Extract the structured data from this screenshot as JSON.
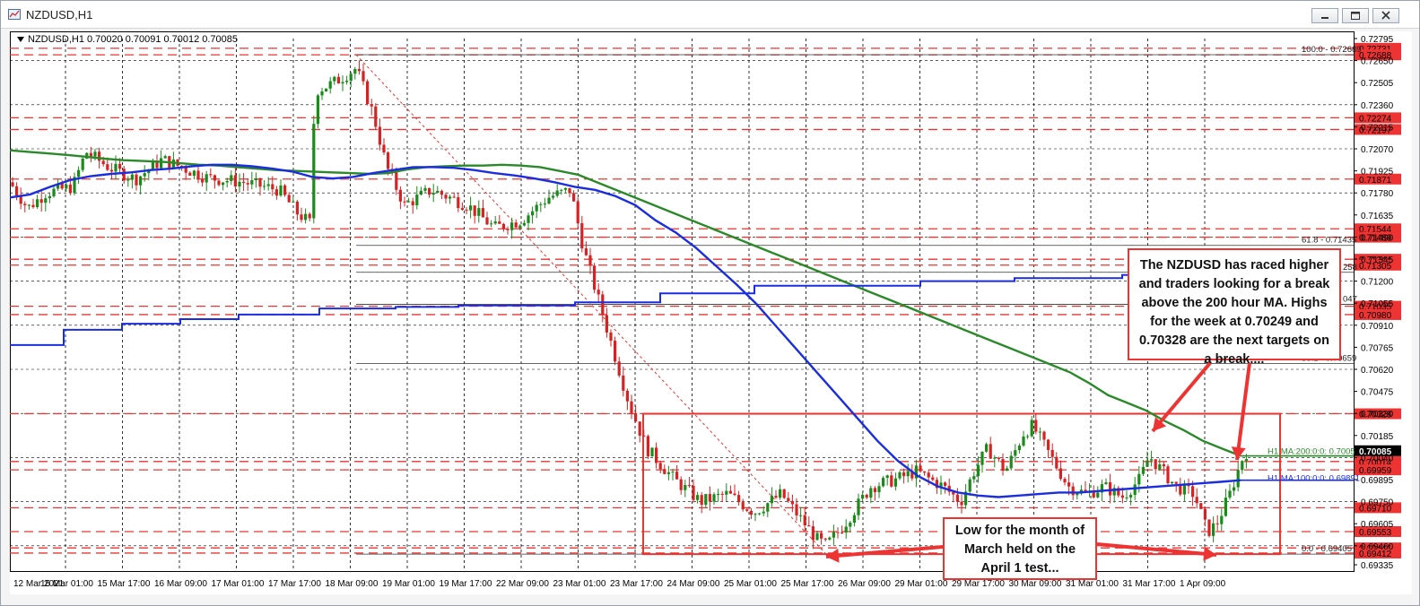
{
  "window": {
    "title": "NZDUSD,H1"
  },
  "header": {
    "symbol": "NZDUSD,H1",
    "open": "0.70020",
    "high": "0.70091",
    "low": "0.70012",
    "close": "0.70085"
  },
  "chart_data": {
    "type": "candlestick",
    "grid": true,
    "ylim": [
      0.69335,
      0.72795
    ],
    "y_ticks": [
      "0.72795",
      "0.72650",
      "0.72505",
      "0.72360",
      "0.72215",
      "0.72070",
      "0.71925",
      "0.71780",
      "0.71635",
      "0.71490",
      "0.71345",
      "0.71200",
      "0.71055",
      "0.70910",
      "0.70765",
      "0.70620",
      "0.70475",
      "0.70330",
      "0.70185",
      "0.70040",
      "0.69895",
      "0.69750",
      "0.69605",
      "0.69460",
      "0.69335"
    ],
    "x_labels": [
      "12 Mar 2021",
      "15 Mar 01:00",
      "15 Mar 17:00",
      "16 Mar 09:00",
      "17 Mar 01:00",
      "17 Mar 17:00",
      "18 Mar 09:00",
      "19 Mar 01:00",
      "19 Mar 17:00",
      "22 Mar 09:00",
      "23 Mar 01:00",
      "23 Mar 17:00",
      "24 Mar 09:00",
      "25 Mar 01:00",
      "25 Mar 17:00",
      "26 Mar 09:00",
      "29 Mar 01:00",
      "29 Mar 17:00",
      "30 Mar 09:00",
      "31 Mar 01:00",
      "31 Mar 17:00",
      "1 Apr 09:00"
    ],
    "h_levels": [
      {
        "value": 0.72731,
        "label": "0.72731"
      },
      {
        "value": 0.72688,
        "label": "0.72688"
      },
      {
        "value": 0.72274,
        "label": "0.72274"
      },
      {
        "value": 0.72197,
        "label": "0.72197"
      },
      {
        "value": 0.71871,
        "label": "0.71871"
      },
      {
        "value": 0.71544,
        "label": "0.71544"
      },
      {
        "value": 0.71489,
        "label": "0.71489"
      },
      {
        "value": 0.71344,
        "label": "0.71344"
      },
      {
        "value": 0.71305,
        "label": "0.71305"
      },
      {
        "value": 0.71035,
        "label": "0.71035"
      },
      {
        "value": 0.7098,
        "label": "0.70980"
      },
      {
        "value": 0.70328,
        "label": "0.70328"
      },
      {
        "value": 0.70014,
        "label": "0.70014"
      },
      {
        "value": 0.69959,
        "label": "0.69959"
      },
      {
        "value": 0.6971,
        "label": "0.69710"
      },
      {
        "value": 0.69553,
        "label": "0.69553"
      },
      {
        "value": 0.69446,
        "label": "0.69446"
      },
      {
        "value": 0.69412,
        "label": "0.69412"
      }
    ],
    "current_price": {
      "value": 0.70085,
      "label": "0.70085"
    },
    "fibo": [
      {
        "value": 0.72689,
        "label": "100.0 - 0.72689"
      },
      {
        "value": 0.71435,
        "label": "61.8 - 0.71435"
      },
      {
        "value": 0.71258,
        "label": "258"
      },
      {
        "value": 0.71047,
        "label": "047"
      },
      {
        "value": 0.70659,
        "label": "38.2 - 0.70659"
      },
      {
        "value": 0.69405,
        "label": "0.0 - 0.69405"
      }
    ],
    "ma_labels": {
      "ma200": "H1 MA:200:0:0: 0.70051",
      "ma100": "H1 MA:100:0:0: 0.69891"
    },
    "colors": {
      "bull": "#1a8a1a",
      "bear": "#d62222",
      "ma100": "#1a2ee0",
      "ma200": "#2a8a2a",
      "level": "#ee3333",
      "price_tag": "#000000"
    },
    "ohlc_ma200": [
      0.7206,
      0.7205,
      0.7204,
      0.7203,
      0.72018,
      0.72005,
      0.71995,
      0.7199,
      0.71985,
      0.71975,
      0.71965,
      0.7196,
      0.7195,
      0.7194,
      0.7193,
      0.71925,
      0.7192,
      0.71915,
      0.7191,
      0.71905,
      0.7191,
      0.71935,
      0.7195,
      0.71955,
      0.7196,
      0.7196,
      0.71965,
      0.7196,
      0.7195,
      0.71925,
      0.719,
      0.7185,
      0.718,
      0.7175,
      0.717,
      0.7165,
      0.716,
      0.7155,
      0.715,
      0.7145,
      0.714,
      0.7135,
      0.713,
      0.7125,
      0.712,
      0.7115,
      0.711,
      0.7105,
      0.71,
      0.7095,
      0.709,
      0.7085,
      0.708,
      0.7075,
      0.707,
      0.7065,
      0.706,
      0.7053,
      0.7045,
      0.704,
      0.7035,
      0.7028,
      0.7022,
      0.7015,
      0.701,
      0.70051
    ],
    "ohlc_ma100": [
      0.7175,
      0.7177,
      0.7182,
      0.71865,
      0.7189,
      0.71905,
      0.71915,
      0.7193,
      0.7194,
      0.71955,
      0.71965,
      0.71965,
      0.71955,
      0.7194,
      0.7192,
      0.71885,
      0.71875,
      0.71885,
      0.7191,
      0.7193,
      0.7195,
      0.7195,
      0.71945,
      0.7193,
      0.7191,
      0.71895,
      0.71875,
      0.7185,
      0.7182,
      0.718,
      0.7176,
      0.717,
      0.716,
      0.7152,
      0.7142,
      0.713,
      0.7118,
      0.7105,
      0.709,
      0.7075,
      0.706,
      0.7045,
      0.703,
      0.7015,
      0.7002,
      0.6992,
      0.6985,
      0.6981,
      0.6979,
      0.6978,
      0.6979,
      0.698,
      0.6981,
      0.6981,
      0.6982,
      0.6983,
      0.6984,
      0.6985,
      0.6986,
      0.6987,
      0.6988,
      0.69891
    ]
  },
  "callouts": {
    "main": "The NZDUSD has raced higher and traders looking for a break above the 200 hour MA. Highs for the week at 0.70249 and 0.70328 are the next targets on a break....",
    "low": "Low for the month of March held on the April 1 test..."
  }
}
